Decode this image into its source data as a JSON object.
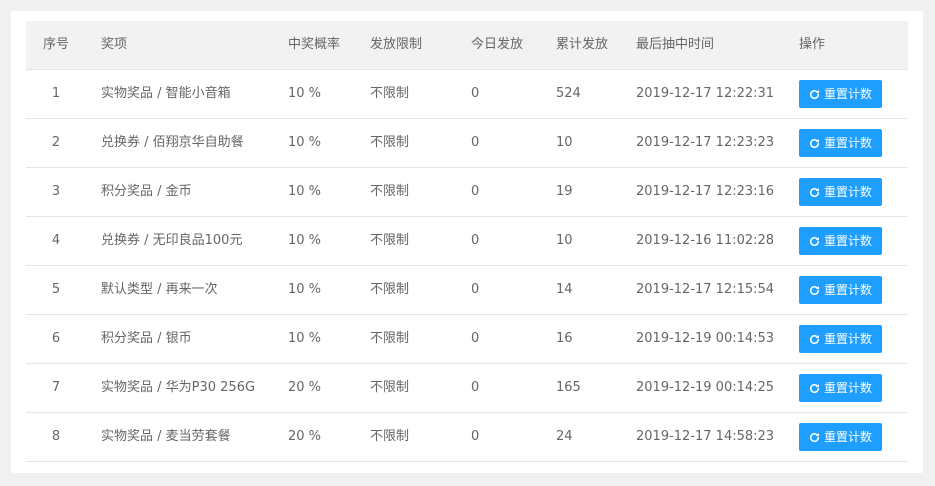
{
  "table": {
    "headers": {
      "idx": "序号",
      "name": "奖项",
      "prob": "中奖概率",
      "limit": "发放限制",
      "today": "今日发放",
      "total": "累计发放",
      "time": "最后抽中时间",
      "op": "操作"
    },
    "reset_label": "重置计数",
    "rows": [
      {
        "idx": "1",
        "name": "实物奖品 / 智能小音箱",
        "prob": "10 %",
        "limit": "不限制",
        "today": "0",
        "total": "524",
        "time": "2019-12-17 12:22:31"
      },
      {
        "idx": "2",
        "name": "兑换券 / 佰翔京华自助餐",
        "prob": "10 %",
        "limit": "不限制",
        "today": "0",
        "total": "10",
        "time": "2019-12-17 12:23:23"
      },
      {
        "idx": "3",
        "name": "积分奖品 / 金币",
        "prob": "10 %",
        "limit": "不限制",
        "today": "0",
        "total": "19",
        "time": "2019-12-17 12:23:16"
      },
      {
        "idx": "4",
        "name": "兑换券 / 无印良品100元",
        "prob": "10 %",
        "limit": "不限制",
        "today": "0",
        "total": "10",
        "time": "2019-12-16 11:02:28"
      },
      {
        "idx": "5",
        "name": "默认类型 / 再来一次",
        "prob": "10 %",
        "limit": "不限制",
        "today": "0",
        "total": "14",
        "time": "2019-12-17 12:15:54"
      },
      {
        "idx": "6",
        "name": "积分奖品 / 银币",
        "prob": "10 %",
        "limit": "不限制",
        "today": "0",
        "total": "16",
        "time": "2019-12-19 00:14:53"
      },
      {
        "idx": "7",
        "name": "实物奖品 / 华为P30 256G",
        "prob": "20 %",
        "limit": "不限制",
        "today": "0",
        "total": "165",
        "time": "2019-12-19 00:14:25"
      },
      {
        "idx": "8",
        "name": "实物奖品 / 麦当劳套餐",
        "prob": "20 %",
        "limit": "不限制",
        "today": "0",
        "total": "24",
        "time": "2019-12-17 14:58:23"
      }
    ]
  },
  "icons": {
    "reset": "refresh-icon"
  },
  "colors": {
    "button": "#1e9fff",
    "header_bg": "#f2f2f2"
  }
}
